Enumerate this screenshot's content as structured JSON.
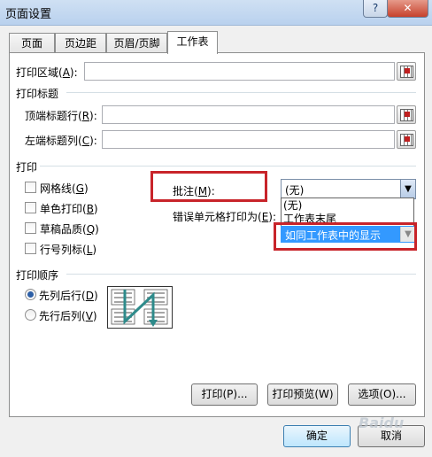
{
  "window": {
    "title": "页面设置",
    "help_glyph": "?",
    "close_glyph": "✕"
  },
  "tabs": [
    {
      "label": "页面"
    },
    {
      "label": "页边距"
    },
    {
      "label": "页眉/页脚"
    },
    {
      "label": "工作表"
    }
  ],
  "print_area": {
    "label": "打印区域(",
    "key": "A",
    "suffix": "):",
    "value": ""
  },
  "print_titles": {
    "section_label": "打印标题",
    "top_rows": {
      "label": "顶端标题行(",
      "key": "R",
      "suffix": "):",
      "value": ""
    },
    "left_cols": {
      "label": "左端标题列(",
      "key": "C",
      "suffix": "):",
      "value": ""
    }
  },
  "print_section": {
    "label": "打印",
    "gridlines": {
      "label": "网格线(",
      "key": "G",
      "suffix": ")",
      "checked": false
    },
    "bw": {
      "label": "单色打印(",
      "key": "B",
      "suffix": ")",
      "checked": false
    },
    "draft": {
      "label": "草稿品质(",
      "key": "Q",
      "suffix": ")",
      "checked": false
    },
    "headings": {
      "label": "行号列标(",
      "key": "L",
      "suffix": ")",
      "checked": false
    },
    "comments": {
      "label": "批注(",
      "key": "M",
      "suffix": "):",
      "value": "(无)"
    },
    "errors": {
      "label": "错误单元格打印为(",
      "key": "E",
      "suffix": "):",
      "value": "如同工作表中的显示"
    },
    "comments_options": [
      "(无)",
      "工作表末尾",
      "如同工作表中的显示"
    ]
  },
  "page_order": {
    "label": "打印顺序",
    "down_then_over": {
      "label": "先列后行(",
      "key": "D",
      "suffix": ")",
      "selected": true
    },
    "over_then_down": {
      "label": "先行后列(",
      "key": "V",
      "suffix": ")",
      "selected": false
    }
  },
  "buttons": {
    "print": "打印(P)...",
    "preview": "打印预览(W)",
    "options": "选项(O)...",
    "ok": "确定",
    "cancel": "取消"
  },
  "watermark": "Baidu"
}
